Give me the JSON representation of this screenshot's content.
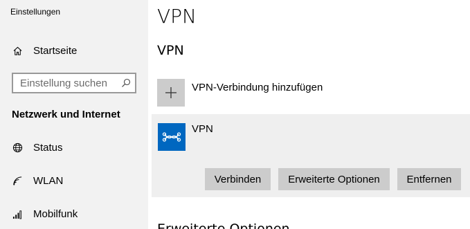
{
  "window": {
    "app_title": "Einstellungen"
  },
  "sidebar": {
    "home": {
      "label": "Startseite",
      "icon": "home-icon"
    },
    "search": {
      "placeholder": "Einstellung suchen",
      "icon": "search-icon"
    },
    "section_heading": "Netzwerk und Internet",
    "items": [
      {
        "label": "Status",
        "icon": "globe-icon"
      },
      {
        "label": "WLAN",
        "icon": "wifi-icon"
      },
      {
        "label": "Mobilfunk",
        "icon": "cellular-signal-icon"
      }
    ]
  },
  "main": {
    "page_title": "VPN",
    "section_title": "VPN",
    "add_connection": {
      "label": "VPN-Verbindung hinzufügen",
      "icon": "plus-icon"
    },
    "connection": {
      "name": "VPN",
      "icon": "vpn-icon",
      "buttons": {
        "connect": "Verbinden",
        "advanced": "Erweiterte Optionen",
        "remove": "Entfernen"
      }
    },
    "next_section_title": "Erweiterte Optionen"
  },
  "colors": {
    "sidebar_bg": "#f2f2f2",
    "accent": "#0067c0",
    "card_bg": "#efefef",
    "button_bg": "#cccccc"
  }
}
